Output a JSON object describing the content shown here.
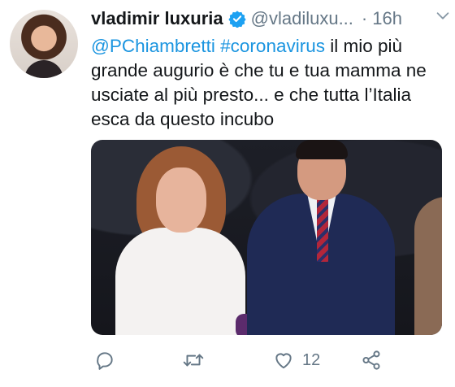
{
  "tweet": {
    "author_name": "vladimir luxuria",
    "handle": "@vladiluxu...",
    "separator": "·",
    "time": "16h",
    "text_segments": {
      "mention": "@PChiambretti",
      "hashtag": "#coronavirus",
      "body": " il mio più grande augurio è che tu e tua mamma ne usciate al più presto... e che tutta l’Italia esca da questo incubo"
    },
    "icons": {
      "verified": "verified-badge-icon",
      "caret": "chevron-down-icon",
      "reply": "reply-icon",
      "retweet": "retweet-icon",
      "like": "heart-icon",
      "share": "share-icon"
    },
    "actions": {
      "reply_count": "",
      "retweet_count": "",
      "like_count": "12"
    }
  },
  "colors": {
    "link": "#1b95e0",
    "secondary_text": "#657786",
    "primary_text": "#14171a"
  }
}
